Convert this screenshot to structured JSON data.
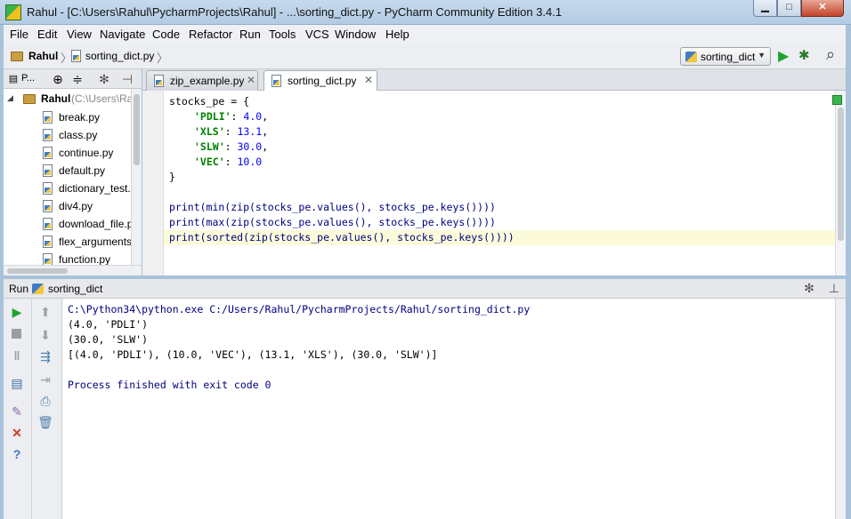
{
  "window": {
    "title": "Rahul - [C:\\Users\\Rahul\\PycharmProjects\\Rahul] - ...\\sorting_dict.py - PyCharm Community Edition 3.4.1",
    "min_glyph": "▁",
    "max_glyph": "□",
    "close_glyph": "✕"
  },
  "menu": [
    "File",
    "Edit",
    "View",
    "Navigate",
    "Code",
    "Refactor",
    "Run",
    "Tools",
    "VCS",
    "Window",
    "Help"
  ],
  "navbar": {
    "crumbs": [
      "Rahul",
      "sorting_dict.py"
    ],
    "run_config": "sorting_dict",
    "run_glyph": "▶",
    "debug_glyph": "✱",
    "search_glyph": "⌕"
  },
  "project": {
    "toolbar_label": "P...",
    "root_label": "Rahul",
    "root_path": "(C:\\Users\\Ra",
    "files": [
      "break.py",
      "class.py",
      "continue.py",
      "default.py",
      "dictionary_test.",
      "div4.py",
      "download_file.p",
      "flex_arguments",
      "function.py"
    ]
  },
  "editor": {
    "tabs": [
      {
        "label": "zip_example.py",
        "active": false
      },
      {
        "label": "sorting_dict.py",
        "active": true
      }
    ],
    "code": {
      "l1": "stocks_pe = {",
      "l2_key": "'PDLI'",
      "l2_val": "4.0",
      "l3_key": "'XLS'",
      "l3_val": "13.1",
      "l4_key": "'SLW'",
      "l4_val": "30.0",
      "l5_key": "'VEC'",
      "l5_val": "10.0",
      "l6": "}",
      "l8": "print(min(zip(stocks_pe.values(), stocks_pe.keys())))",
      "l9": "print(max(zip(stocks_pe.values(), stocks_pe.keys())))",
      "l10": "print(sorted(zip(stocks_pe.values(), stocks_pe.keys())))"
    }
  },
  "run_panel": {
    "title": "Run",
    "config": "sorting_dict",
    "console": {
      "cmd": "C:\\Python34\\python.exe C:/Users/Rahul/PycharmProjects/Rahul/sorting_dict.py",
      "out1": "(4.0, 'PDLI')",
      "out2": "(30.0, 'SLW')",
      "out3": "[(4.0, 'PDLI'), (10.0, 'VEC'), (13.1, 'XLS'), (30.0, 'SLW')]",
      "exit": "Process finished with exit code 0"
    }
  },
  "colors": {
    "keyword": "#000080",
    "string": "#008000",
    "number": "#0000ff",
    "highlight_line": "#fbfbda",
    "run_green": "#1fa232"
  }
}
